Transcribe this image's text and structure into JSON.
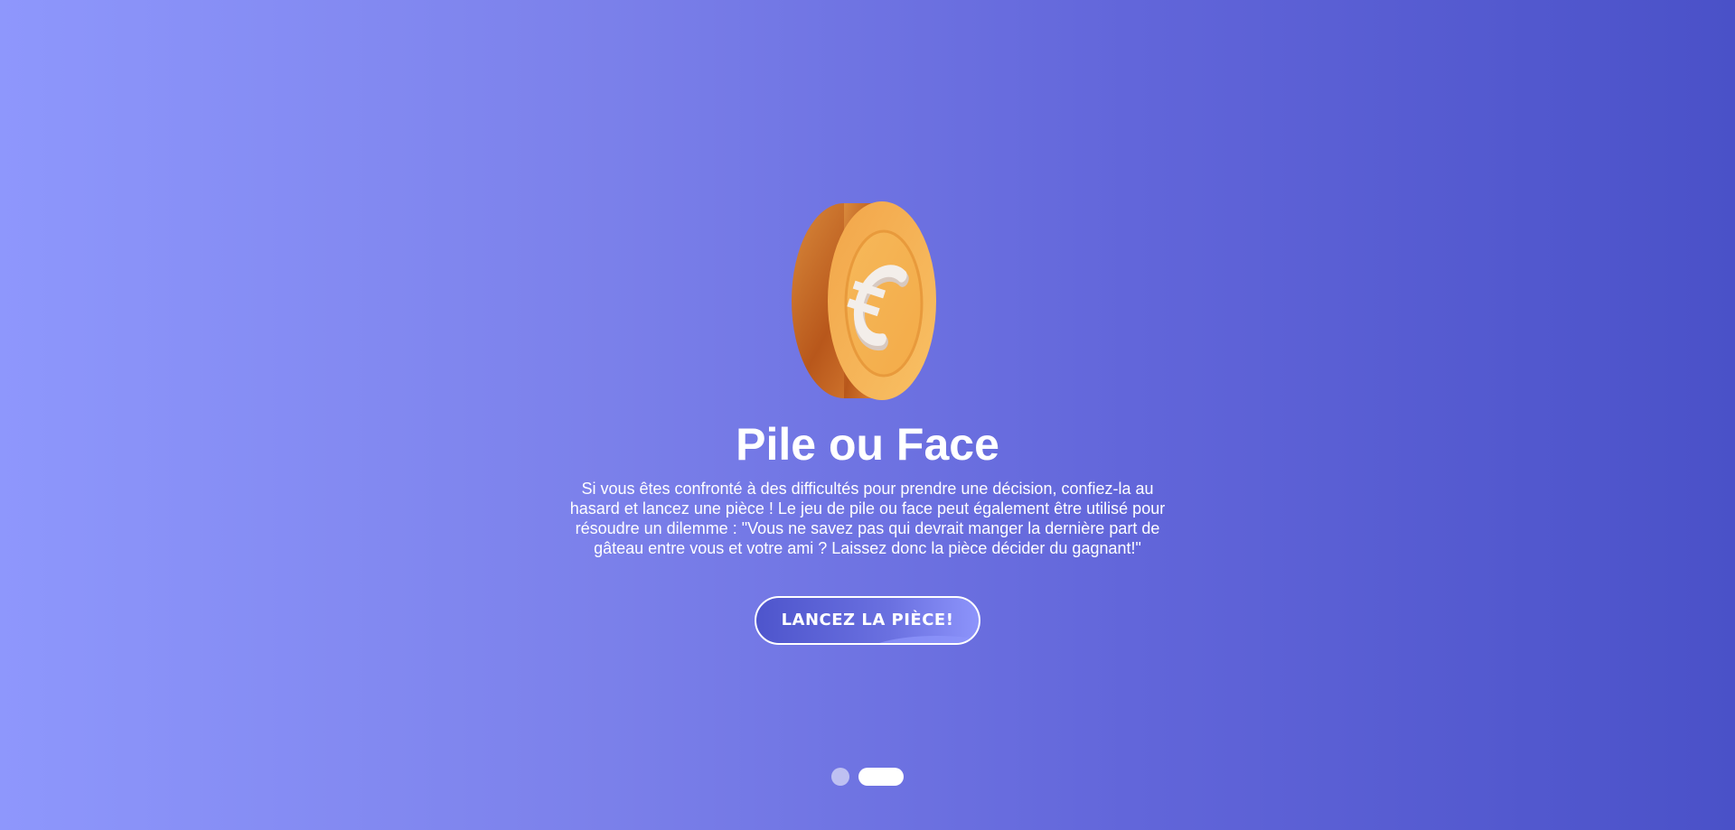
{
  "hero": {
    "coin_icon": "euro-coin-icon",
    "title": "Pile ou Face",
    "description": "Si vous êtes confronté à des difficultés pour prendre une décision, confiez-la au hasard et lancez une pièce ! Le jeu de pile ou face peut également être utilisé pour résoudre un dilemme : \"Vous ne savez pas qui devrait manger la dernière part de gâteau entre vous et votre ami ? Laissez donc la pièce décider du gagnant!\"",
    "button_label": "LANCEZ LA PIÈCE!"
  },
  "pager": {
    "slide_count": 2,
    "active_index": 1
  },
  "colors": {
    "background_start": "#8e97fc",
    "background_end": "#4a51c8",
    "coin_face": "#f6b04a",
    "coin_edge": "#cd6d22",
    "button_fill": "#4e55cc",
    "text": "#ffffff"
  }
}
